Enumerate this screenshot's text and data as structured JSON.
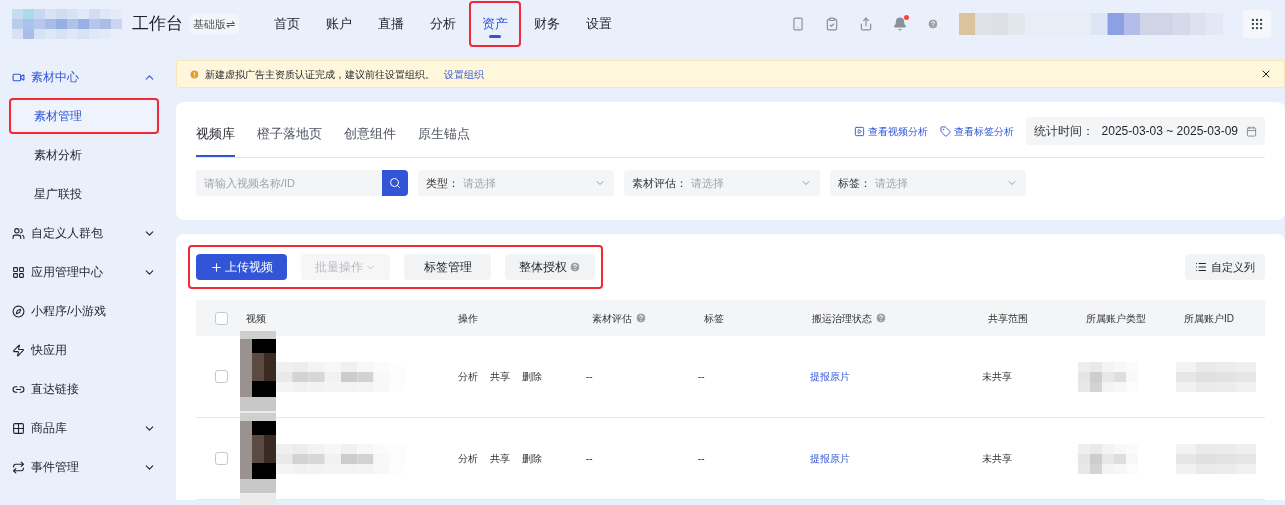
{
  "header": {
    "title": "工作台",
    "edition": "基础版⇌",
    "nav": [
      {
        "label": "首页",
        "selected": false,
        "highlighted": false
      },
      {
        "label": "账户",
        "selected": false,
        "highlighted": false
      },
      {
        "label": "直播",
        "selected": false,
        "highlighted": false
      },
      {
        "label": "分析",
        "selected": false,
        "highlighted": false
      },
      {
        "label": "资产",
        "selected": true,
        "highlighted": true
      },
      {
        "label": "财务",
        "selected": false,
        "highlighted": false
      },
      {
        "label": "设置",
        "selected": false,
        "highlighted": false
      }
    ],
    "notification_dot": true
  },
  "sidebar": {
    "items": [
      {
        "label": "素材中心",
        "expanded": true,
        "selected": true,
        "children": [
          {
            "label": "素材管理",
            "selected": true,
            "highlighted": true
          },
          {
            "label": "素材分析",
            "selected": false,
            "highlighted": false
          },
          {
            "label": "星广联投",
            "selected": false,
            "highlighted": false
          }
        ]
      },
      {
        "label": "自定义人群包",
        "expanded": false,
        "selected": false
      },
      {
        "label": "应用管理中心",
        "expanded": false,
        "selected": false
      },
      {
        "label": "小程序/小游戏",
        "selected": false
      },
      {
        "label": "快应用",
        "selected": false
      },
      {
        "label": "直达链接",
        "selected": false
      },
      {
        "label": "商品库",
        "expanded": false,
        "selected": false
      },
      {
        "label": "事件管理",
        "expanded": false,
        "selected": false
      }
    ]
  },
  "notice": {
    "text": "新建虚拟广告主资质认证完成，建议前往设置组织。",
    "link": "设置组织"
  },
  "library": {
    "tabs": [
      {
        "label": "视频库",
        "selected": true
      },
      {
        "label": "橙子落地页",
        "selected": false
      },
      {
        "label": "创意组件",
        "selected": false
      },
      {
        "label": "原生锚点",
        "selected": false
      }
    ],
    "links": [
      {
        "label": "查看视频分析"
      },
      {
        "label": "查看标签分析"
      }
    ],
    "date_range": {
      "label": "统计时间：",
      "value": "2025-03-03 ~ 2025-03-09"
    },
    "search": {
      "placeholder": "请输入视频名称/ID"
    },
    "filters": [
      {
        "label": "类型：",
        "placeholder": "请选择"
      },
      {
        "label": "素材评估：",
        "placeholder": "请选择"
      },
      {
        "label": "标签：",
        "placeholder": "请选择"
      }
    ]
  },
  "toolbar": {
    "highlighted": true,
    "buttons": [
      {
        "label": "上传视频",
        "kind": "primary",
        "disabled": false
      },
      {
        "label": "批量操作",
        "kind": "dropdown",
        "disabled": true
      },
      {
        "label": "标签管理",
        "kind": "plain",
        "disabled": false
      },
      {
        "label": "整体授权",
        "kind": "help",
        "disabled": false
      }
    ],
    "columns_button": "自定义列"
  },
  "table": {
    "all_checked": false,
    "columns": [
      {
        "label": "视频"
      },
      {
        "label": "操作"
      },
      {
        "label": "素材评估",
        "help": true
      },
      {
        "label": "标签"
      },
      {
        "label": "搬运治理状态",
        "help": true
      },
      {
        "label": "共享范围"
      },
      {
        "label": "所属账户类型"
      },
      {
        "label": "所属账户ID"
      }
    ],
    "rows": [
      {
        "checked": false,
        "actions": [
          "分析",
          "共享",
          "删除"
        ],
        "evaluation": "--",
        "tags": "--",
        "status": "提报原片",
        "share": "未共享"
      },
      {
        "checked": false,
        "actions": [
          "分析",
          "共享",
          "删除"
        ],
        "evaluation": "--",
        "tags": "--",
        "status": "提报原片",
        "share": "未共享"
      }
    ]
  }
}
